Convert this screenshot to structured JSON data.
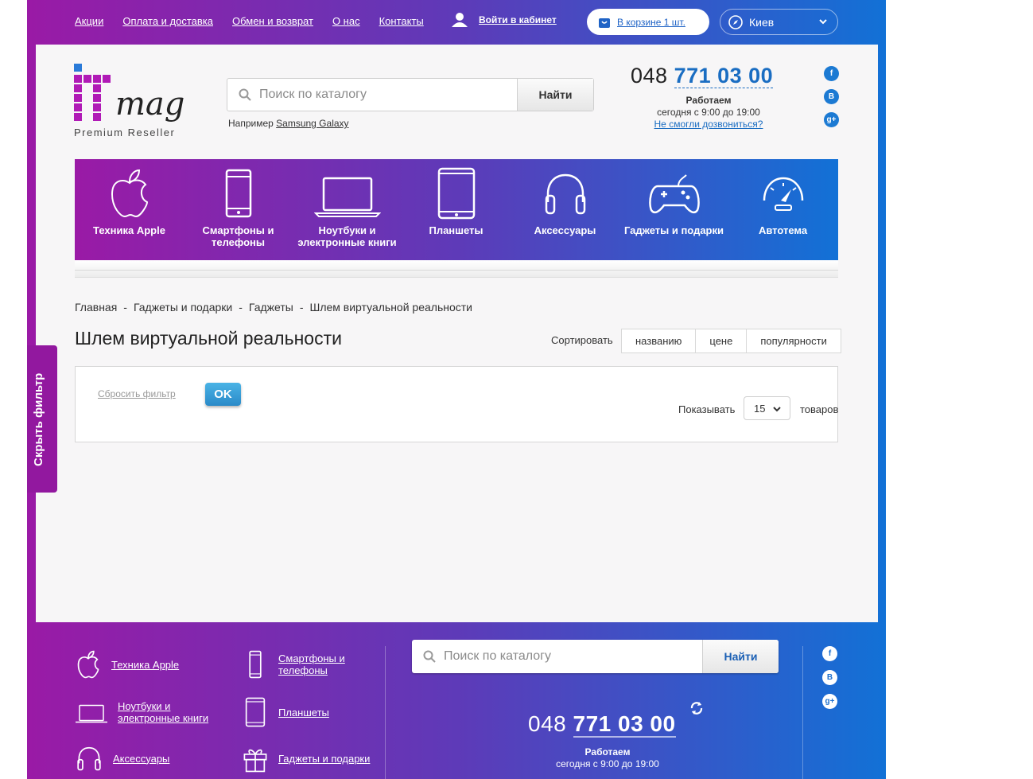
{
  "topnav": {
    "links": [
      "Акции",
      "Оплата и доставка",
      "Обмен и возврат",
      "О нас",
      "Контакты"
    ],
    "login": "Войти в кабинет",
    "cart": "В корзине 1 шт.",
    "city": "Киев"
  },
  "header": {
    "logo_sub": "Premium Reseller",
    "search_placeholder": "Поиск по каталогу",
    "search_button": "Найти",
    "hint_prefix": "Например",
    "hint_link": "Samsung Galaxy",
    "phone_code": "048",
    "phone_number": "771 03 00",
    "work_title": "Работаем",
    "work_hours": "сегодня с 9:00 до 19:00",
    "callback_link": "Не смогли дозвониться?",
    "social": [
      "f",
      "B",
      "g+"
    ]
  },
  "categories": [
    {
      "label": "Техника Apple",
      "icon": "apple-icon"
    },
    {
      "label": "Смартфоны и телефоны",
      "icon": "smartphone-icon"
    },
    {
      "label": "Ноутбуки и электронные книги",
      "icon": "laptop-icon"
    },
    {
      "label": "Планшеты",
      "icon": "tablet-icon"
    },
    {
      "label": "Аксессуары",
      "icon": "headphones-icon"
    },
    {
      "label": "Гаджеты и подарки",
      "icon": "gamepad-icon"
    },
    {
      "label": "Автотема",
      "icon": "speedometer-icon"
    }
  ],
  "breadcrumb": [
    "Главная",
    "Гаджеты и подарки",
    "Гаджеты",
    "Шлем виртуальной реальности"
  ],
  "page_title": "Шлем виртуальной реальности",
  "sort": {
    "label": "Сортировать",
    "options": [
      "названию",
      "цене",
      "популярности"
    ]
  },
  "filter": {
    "reset": "Сбросить фильтр",
    "ok": "OK",
    "show_label": "Показывать",
    "show_value": "15",
    "show_suffix": "товаров",
    "hide_filter": "Скрыть фильтр"
  },
  "footer": {
    "categories": [
      "Техника Apple",
      "Смартфоны и телефоны",
      "Ноутбуки и электронные книги",
      "Планшеты",
      "Аксессуары",
      "Гаджеты и подарки"
    ],
    "search_placeholder": "Поиск по каталогу",
    "search_button": "Найти",
    "phone_code": "048",
    "phone_number": "771 03 00",
    "work_title": "Работаем",
    "work_hours": "сегодня с 9:00 до 19:00",
    "social": [
      "f",
      "B",
      "g+"
    ]
  },
  "colors": {
    "gradient_start": "#9a1aa6",
    "gradient_end": "#1271d6",
    "link_blue": "#1a6dc2"
  }
}
